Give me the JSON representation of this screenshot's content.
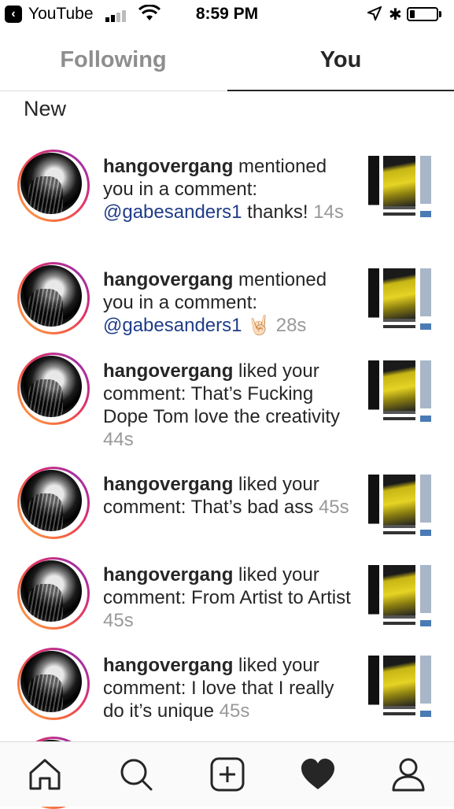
{
  "status_bar": {
    "back_app": "YouTube",
    "time": "8:59 PM"
  },
  "tabs": [
    {
      "label": "Following"
    },
    {
      "label": "You"
    }
  ],
  "section_title": "New",
  "notifications": [
    {
      "user": "hangovergang",
      "action": " mentioned you in a comment: ",
      "mention": "@gabesanders1",
      "comment": " thanks!",
      "time": "14s"
    },
    {
      "user": "hangovergang",
      "action": " mentioned you in a comment: ",
      "mention": "@gabesanders1",
      "comment": " 🤘🏻",
      "time": "28s"
    },
    {
      "user": "hangovergang",
      "action": " liked your comment: ",
      "mention": "",
      "comment": "That’s Fucking Dope Tom love the creativity",
      "time": "44s"
    },
    {
      "user": "hangovergang",
      "action": " liked your comment: ",
      "mention": "",
      "comment": "That’s bad ass",
      "time": "45s"
    },
    {
      "user": "hangovergang",
      "action": " liked your comment: ",
      "mention": "",
      "comment": "From Artist to Artist",
      "time": "45s"
    },
    {
      "user": "hangovergang",
      "action": " liked your comment: ",
      "mention": "",
      "comment": "I love that I really do it’s unique",
      "time": "45s"
    }
  ],
  "bottom_nav": [
    "home-icon",
    "search-icon",
    "add-post-icon",
    "heart-icon",
    "profile-icon"
  ]
}
